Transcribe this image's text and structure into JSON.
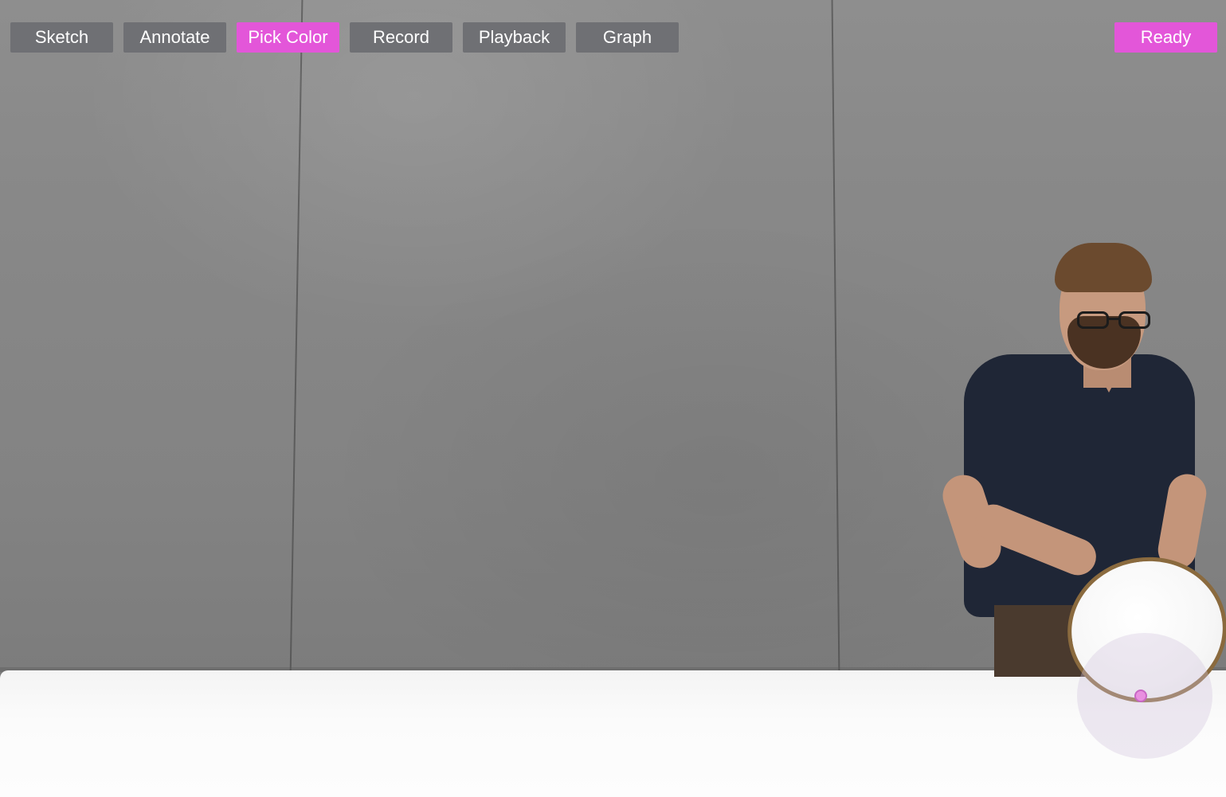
{
  "toolbar": {
    "buttons": [
      {
        "label": "Sketch",
        "active": false
      },
      {
        "label": "Annotate",
        "active": false
      },
      {
        "label": "Pick Color",
        "active": true
      },
      {
        "label": "Record",
        "active": false
      },
      {
        "label": "Playback",
        "active": false
      },
      {
        "label": "Graph",
        "active": false
      }
    ]
  },
  "status": {
    "label": "Ready"
  },
  "colors": {
    "accent": "#e356d9",
    "button_bg": "#6f7074",
    "button_text": "#ffffff"
  }
}
